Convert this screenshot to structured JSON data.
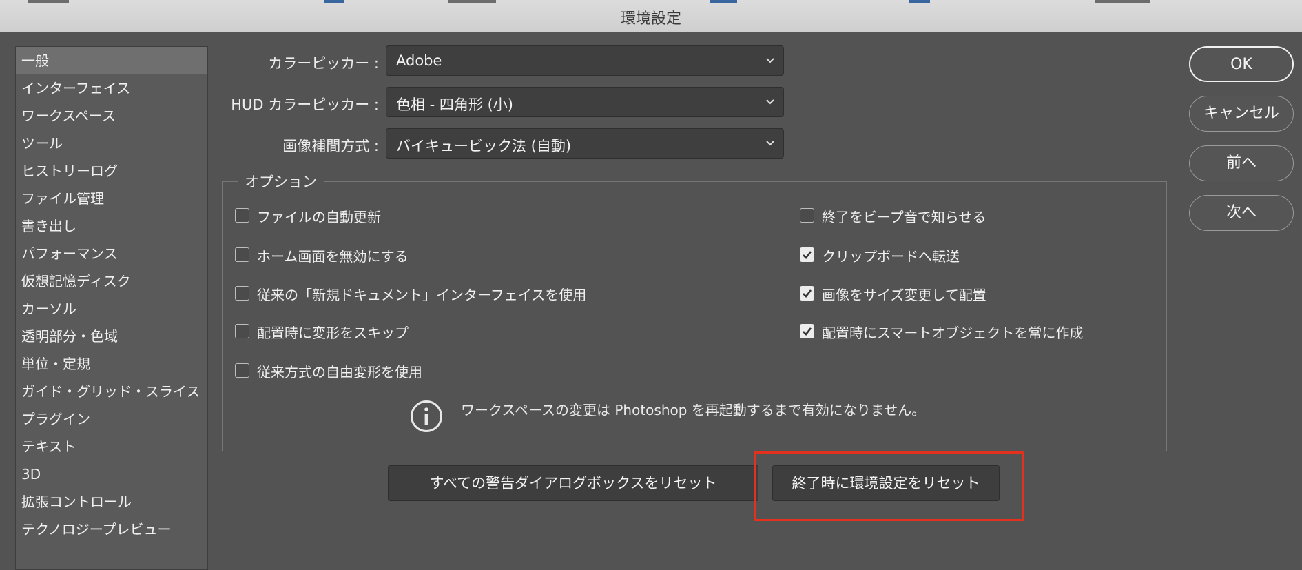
{
  "window": {
    "title": "環境設定"
  },
  "sidebar": {
    "items": [
      {
        "label": "一般",
        "selected": true
      },
      {
        "label": "インターフェイス"
      },
      {
        "label": "ワークスペース"
      },
      {
        "label": "ツール"
      },
      {
        "label": "ヒストリーログ"
      },
      {
        "label": "ファイル管理"
      },
      {
        "label": "書き出し"
      },
      {
        "label": "パフォーマンス"
      },
      {
        "label": "仮想記憶ディスク"
      },
      {
        "label": "カーソル"
      },
      {
        "label": "透明部分・色域"
      },
      {
        "label": "単位・定規"
      },
      {
        "label": "ガイド・グリッド・スライス"
      },
      {
        "label": "プラグイン"
      },
      {
        "label": "テキスト"
      },
      {
        "label": "3D"
      },
      {
        "label": "拡張コントロール"
      },
      {
        "label": "テクノロジープレビュー"
      }
    ]
  },
  "form": {
    "color_picker": {
      "label": "カラーピッカー :",
      "value": "Adobe"
    },
    "hud_color_picker": {
      "label": "HUD カラーピッカー :",
      "value": "色相 - 四角形 (小)"
    },
    "interpolation": {
      "label": "画像補間方式 :",
      "value": "バイキュービック法 (自動)"
    }
  },
  "options": {
    "legend": "オプション",
    "left": [
      {
        "label": "ファイルの自動更新",
        "checked": false
      },
      {
        "label": "ホーム画面を無効にする",
        "checked": false
      },
      {
        "label": "従来の「新規ドキュメント」インターフェイスを使用",
        "checked": false
      },
      {
        "label": "配置時に変形をスキップ",
        "checked": false
      },
      {
        "label": "従来方式の自由変形を使用",
        "checked": false
      }
    ],
    "right": [
      {
        "label": "終了をビープ音で知らせる",
        "checked": false
      },
      {
        "label": "クリップボードへ転送",
        "checked": true
      },
      {
        "label": "画像をサイズ変更して配置",
        "checked": true
      },
      {
        "label": "配置時にスマートオブジェクトを常に作成",
        "checked": true
      }
    ],
    "info_text": "ワークスペースの変更は Photoshop を再起動するまで有効になりません。"
  },
  "buttons": {
    "reset_warnings": "すべての警告ダイアログボックスをリセット",
    "reset_prefs_on_quit": "終了時に環境設定をリセット",
    "ok": "OK",
    "cancel": "キャンセル",
    "prev": "前へ",
    "next": "次へ"
  },
  "colors": {
    "background": "#535353",
    "highlight": "#e2321d"
  }
}
